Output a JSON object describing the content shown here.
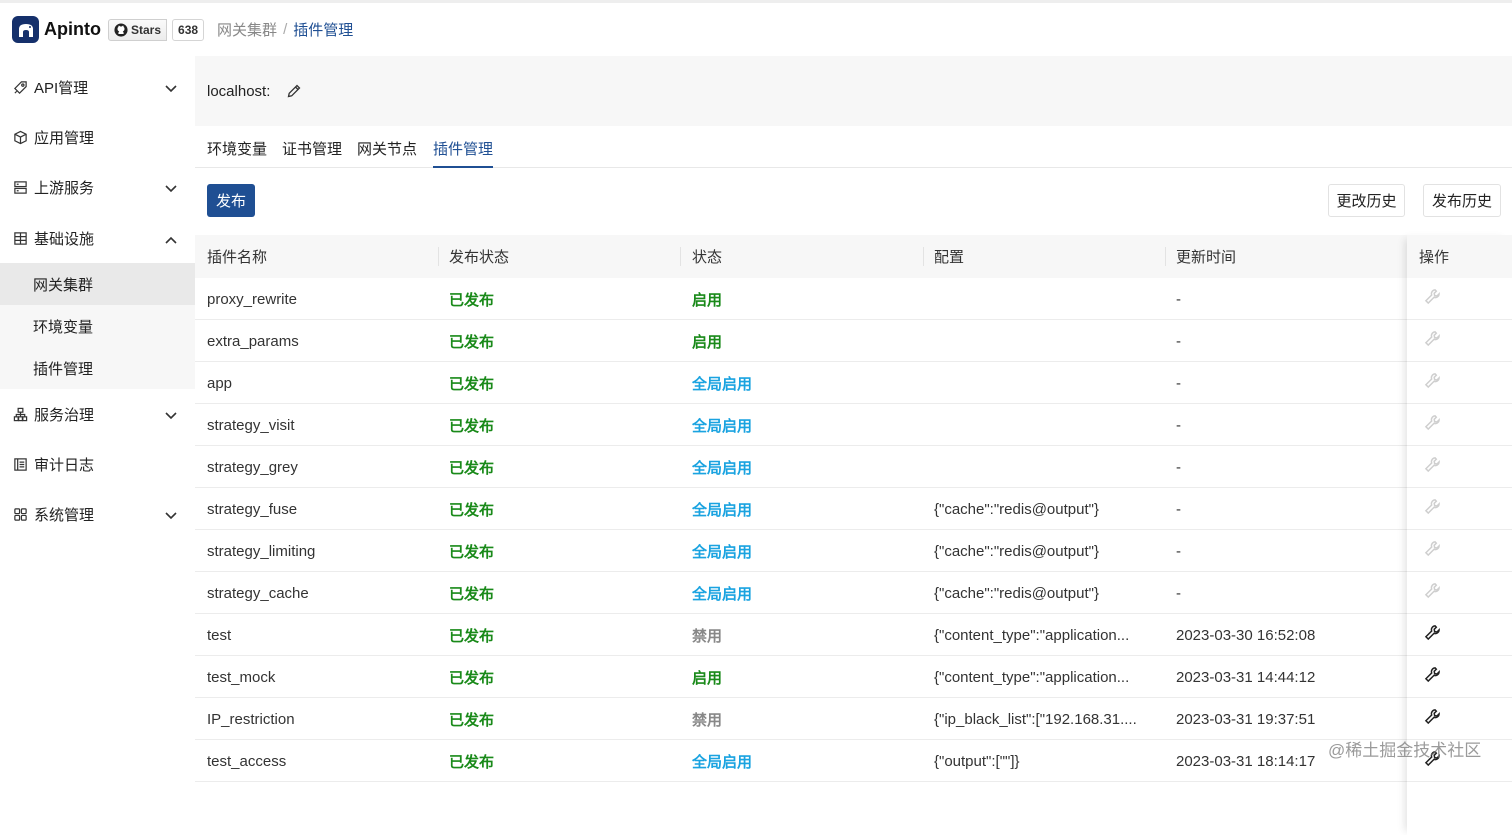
{
  "header": {
    "logo_text": "Apinto",
    "github_label": "Stars",
    "github_count": "638",
    "breadcrumb": [
      "网关集群",
      "插件管理"
    ]
  },
  "sidebar": {
    "items": [
      {
        "label": "API管理",
        "icon": "rocket-icon",
        "chevron": "down"
      },
      {
        "label": "应用管理",
        "icon": "box-icon",
        "chevron": ""
      },
      {
        "label": "上游服务",
        "icon": "server-icon",
        "chevron": "down"
      },
      {
        "label": "基础设施",
        "icon": "grid-icon",
        "chevron": "up"
      },
      {
        "label": "服务治理",
        "icon": "hierarchy-icon",
        "chevron": "down"
      },
      {
        "label": "审计日志",
        "icon": "log-icon",
        "chevron": ""
      },
      {
        "label": "系统管理",
        "icon": "apps-icon",
        "chevron": "down"
      }
    ],
    "sub_items": [
      {
        "label": "网关集群",
        "active": true
      },
      {
        "label": "环境变量",
        "active": false
      },
      {
        "label": "插件管理",
        "active": false
      }
    ]
  },
  "main": {
    "host_label": "localhost:",
    "tabs": [
      {
        "label": "环境变量",
        "active": false
      },
      {
        "label": "证书管理",
        "active": false
      },
      {
        "label": "网关节点",
        "active": false
      },
      {
        "label": "插件管理",
        "active": true
      }
    ],
    "publish_button": "发布",
    "change_history_button": "更改历史",
    "publish_history_button": "发布历史"
  },
  "table": {
    "columns": [
      "插件名称",
      "发布状态",
      "状态",
      "配置",
      "更新时间",
      "操作"
    ],
    "rows": [
      {
        "name": "proxy_rewrite",
        "publish": "已发布",
        "status": "启用",
        "status_kind": "on",
        "config": "",
        "updated": "-",
        "op_enabled": false
      },
      {
        "name": "extra_params",
        "publish": "已发布",
        "status": "启用",
        "status_kind": "on",
        "config": "",
        "updated": "-",
        "op_enabled": false
      },
      {
        "name": "app",
        "publish": "已发布",
        "status": "全局启用",
        "status_kind": "global",
        "config": "",
        "updated": "-",
        "op_enabled": false
      },
      {
        "name": "strategy_visit",
        "publish": "已发布",
        "status": "全局启用",
        "status_kind": "global",
        "config": "",
        "updated": "-",
        "op_enabled": false
      },
      {
        "name": "strategy_grey",
        "publish": "已发布",
        "status": "全局启用",
        "status_kind": "global",
        "config": "",
        "updated": "-",
        "op_enabled": false
      },
      {
        "name": "strategy_fuse",
        "publish": "已发布",
        "status": "全局启用",
        "status_kind": "global",
        "config": "{\"cache\":\"redis@output\"}",
        "updated": "-",
        "op_enabled": false
      },
      {
        "name": "strategy_limiting",
        "publish": "已发布",
        "status": "全局启用",
        "status_kind": "global",
        "config": "{\"cache\":\"redis@output\"}",
        "updated": "-",
        "op_enabled": false
      },
      {
        "name": "strategy_cache",
        "publish": "已发布",
        "status": "全局启用",
        "status_kind": "global",
        "config": "{\"cache\":\"redis@output\"}",
        "updated": "-",
        "op_enabled": false
      },
      {
        "name": "test",
        "publish": "已发布",
        "status": "禁用",
        "status_kind": "off",
        "config": "{\"content_type\":\"application...",
        "updated": "2023-03-30 16:52:08",
        "op_enabled": true
      },
      {
        "name": "test_mock",
        "publish": "已发布",
        "status": "启用",
        "status_kind": "on",
        "config": "{\"content_type\":\"application...",
        "updated": "2023-03-31 14:44:12",
        "op_enabled": true
      },
      {
        "name": "IP_restriction",
        "publish": "已发布",
        "status": "禁用",
        "status_kind": "off",
        "config": "{\"ip_black_list\":[\"192.168.31....",
        "updated": "2023-03-31 19:37:51",
        "op_enabled": true
      },
      {
        "name": "test_access",
        "publish": "已发布",
        "status": "全局启用",
        "status_kind": "global",
        "config": "{\"output\":[\"\"]}",
        "updated": "2023-03-31 18:14:17",
        "op_enabled": true
      }
    ]
  },
  "watermark": "@稀土掘金技术社区",
  "colors": {
    "brand": "#1f4f93",
    "published": "#1a8a1a",
    "global": "#1aa3e0",
    "disabled": "#888888"
  }
}
